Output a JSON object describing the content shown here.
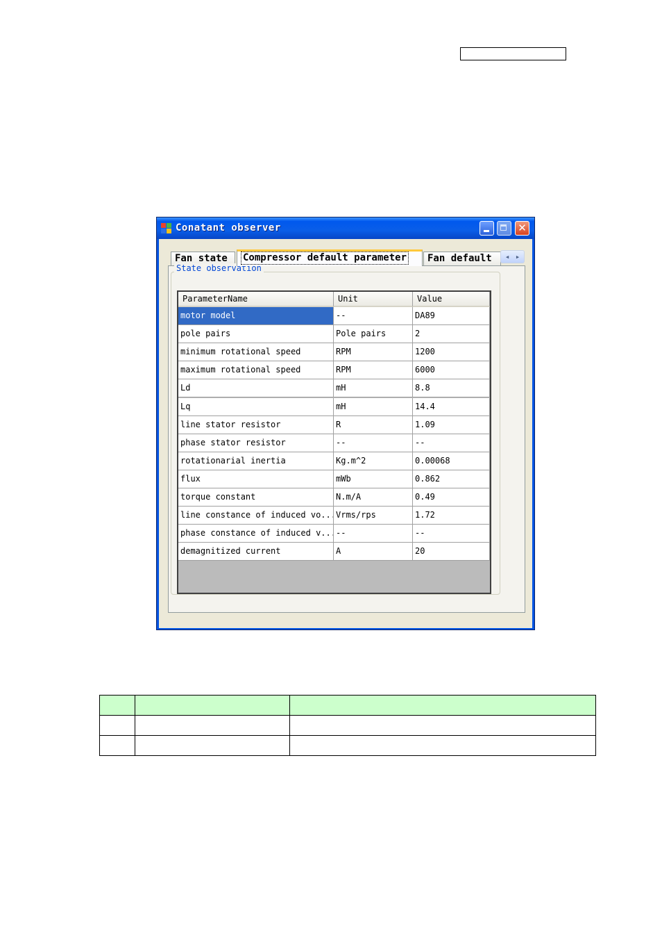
{
  "window": {
    "title": "Conatant observer"
  },
  "tabs": [
    {
      "label": "Fan state"
    },
    {
      "label": "Compressor default parameter"
    },
    {
      "label": "Fan default"
    }
  ],
  "tab_scroll": {
    "left": "◂",
    "right": "▸"
  },
  "group": {
    "title": "State observation"
  },
  "grid": {
    "columns": [
      "ParameterName",
      "Unit",
      "Value"
    ],
    "selected_row": 0,
    "rows": [
      {
        "name": "motor model",
        "unit": "--",
        "value": "DA89"
      },
      {
        "name": "pole pairs",
        "unit": "Pole pairs",
        "value": "2"
      },
      {
        "name": "minimum rotational speed",
        "unit": "RPM",
        "value": "1200"
      },
      {
        "name": "maximum rotational speed",
        "unit": "RPM",
        "value": "6000"
      },
      {
        "name": "Ld",
        "unit": "mH",
        "value": "8.8"
      },
      {
        "name": "Lq",
        "unit": "mH",
        "value": "14.4"
      },
      {
        "name": "line stator resistor",
        "unit": "R",
        "value": "1.09"
      },
      {
        "name": "phase stator resistor",
        "unit": "--",
        "value": "--"
      },
      {
        "name": "rotationarial inertia",
        "unit": "Kg.m^2",
        "value": "0.00068"
      },
      {
        "name": "flux",
        "unit": "mWb",
        "value": "0.862"
      },
      {
        "name": "torque constant",
        "unit": "N.m/A",
        "value": "0.49"
      },
      {
        "name": "line constance of induced vo...",
        "unit": "Vrms/rps",
        "value": "1.72"
      },
      {
        "name": "phase constance of induced v...",
        "unit": "--",
        "value": "--"
      },
      {
        "name": "demagnitized current",
        "unit": "A",
        "value": "20"
      }
    ]
  },
  "colors": {
    "titlebar": "#0058ee",
    "selection": "#316ac5",
    "active_tab_accent": "#ffc83c",
    "group_title": "#0046d5",
    "table_header": "#ccffcc"
  }
}
